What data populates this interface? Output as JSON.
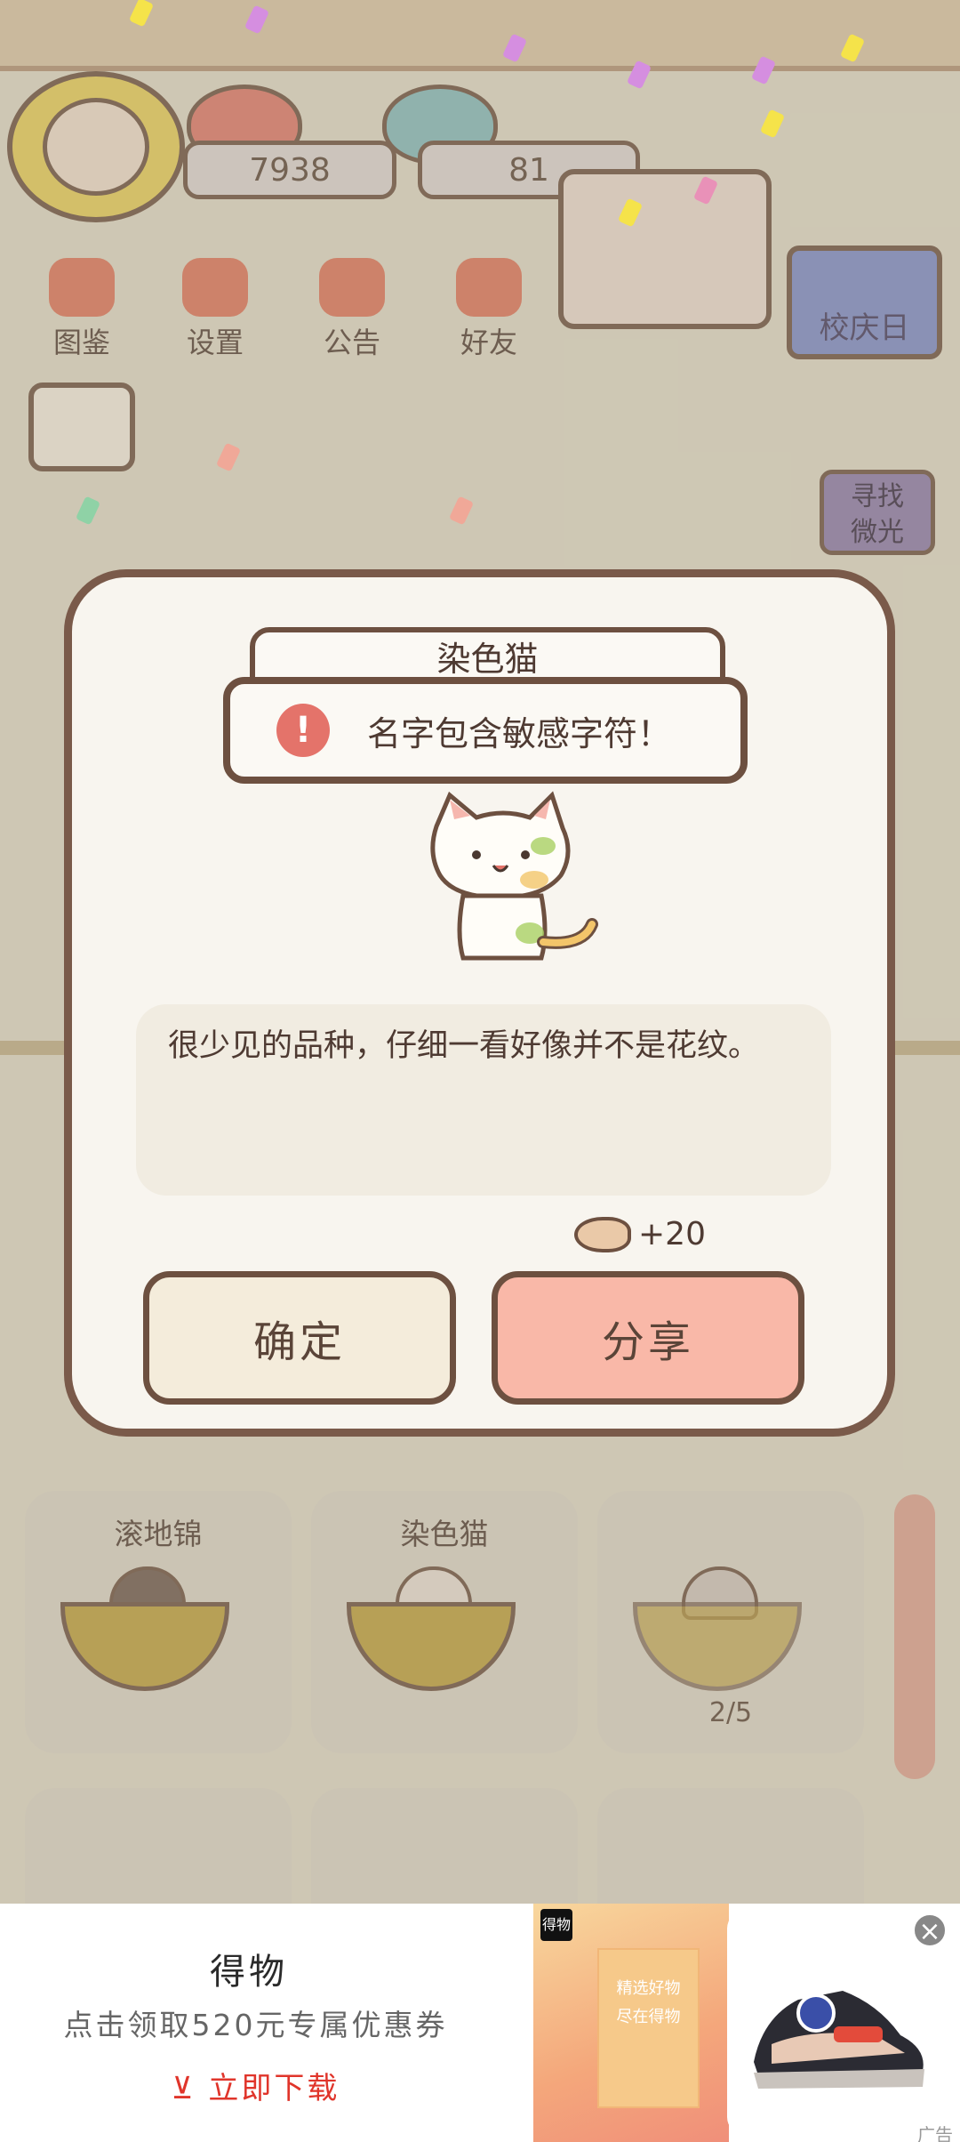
{
  "header": {
    "fish_count": "7938",
    "heart_count": "81"
  },
  "menu": [
    {
      "label": "图鉴",
      "icon": "cat-book-icon"
    },
    {
      "label": "设置",
      "icon": "gear-icon"
    },
    {
      "label": "公告",
      "icon": "gift-icon"
    },
    {
      "label": "好友",
      "icon": "friends-icon"
    }
  ],
  "side": {
    "event_label": "校庆日",
    "seek_label": "寻找\n微光"
  },
  "modal": {
    "name_field": "染色猫",
    "toast_message": "名字包含敏感字符！",
    "toast_icon": "!",
    "description": "很少见的品种，仔细一看好像并不是花纹。",
    "reward": "+20",
    "confirm_label": "确定",
    "share_label": "分享"
  },
  "grid": [
    {
      "name": "滚地锦",
      "progress": ""
    },
    {
      "name": "染色猫",
      "progress": ""
    },
    {
      "name": "",
      "progress": "2/5"
    }
  ],
  "ad": {
    "brand": "得物",
    "subtitle": "点击领取520元专属优惠券",
    "cta": "⊻ 立即下载",
    "logo_text": "得物",
    "poster_text_1": "精选好物",
    "poster_text_2": "尽在得物",
    "close": "×",
    "tag": "广告"
  },
  "colors": {
    "accent_share": "#f9b8a8",
    "accent_confirm": "#f4ecdb",
    "outline": "#6d5040",
    "alert": "#e4736a",
    "cta": "#e0352b"
  }
}
